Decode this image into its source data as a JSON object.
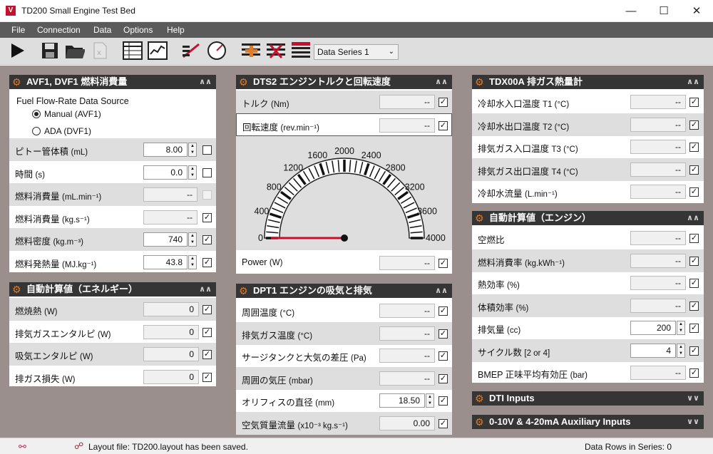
{
  "window": {
    "title": "TD200 Small Engine Test Bed",
    "icon": "V"
  },
  "menu": [
    "File",
    "Connection",
    "Data",
    "Options",
    "Help"
  ],
  "toolbar": {
    "series_value": "Data Series 1"
  },
  "avf": {
    "title": "AVF1, DVF1 燃料消費量",
    "source_label": "Fuel Flow-Rate Data Source",
    "manual": "Manual (AVF1)",
    "ada": "ADA (DVF1)",
    "rows": [
      {
        "label": "ピトー管体積",
        "unit": "(mL)",
        "value": "8.00",
        "spin": true,
        "checked": false,
        "edit": true
      },
      {
        "label": "時間",
        "unit": "(s)",
        "value": "0.0",
        "spin": true,
        "checked": false,
        "edit": true
      },
      {
        "label": "燃料消費量",
        "unit": "(mL.min⁻¹)",
        "value": "--",
        "spin": false,
        "checked": false,
        "disabled": true
      },
      {
        "label": "燃料消費量",
        "unit": "(kg.s⁻¹)",
        "value": "--",
        "spin": false,
        "checked": true
      },
      {
        "label": "燃料密度",
        "unit": "(kg.m⁻³)",
        "value": "740",
        "spin": true,
        "checked": true,
        "edit": true
      },
      {
        "label": "燃料発熱量",
        "unit": "(MJ.kg⁻¹)",
        "value": "43.8",
        "spin": true,
        "checked": true,
        "edit": true
      }
    ]
  },
  "energy": {
    "title": "自動計算値（エネルギー）",
    "rows": [
      {
        "label": "燃焼熱",
        "unit": "(W)",
        "value": "0",
        "checked": true
      },
      {
        "label": "排気ガスエンタルピ",
        "unit": "(W)",
        "value": "0",
        "checked": true
      },
      {
        "label": "吸気エンタルピ",
        "unit": "(W)",
        "value": "0",
        "checked": true
      },
      {
        "label": "排ガス損失",
        "unit": "(W)",
        "value": "0",
        "checked": true
      }
    ]
  },
  "dts": {
    "title": "DTS2 エンジントルクと回転速度",
    "torque": {
      "label": "トルク",
      "unit": "(Nm)",
      "value": "--"
    },
    "speed": {
      "label": "回転速度",
      "unit": "(rev.min⁻¹)",
      "value": "--"
    },
    "gauge_ticks": [
      "0",
      "400",
      "800",
      "1200",
      "1600",
      "2000",
      "2400",
      "2800",
      "3200",
      "3600",
      "4000"
    ],
    "gauge_max": 4000,
    "gauge_value": 0,
    "power": {
      "label": "Power",
      "unit": "(W)",
      "value": "--"
    }
  },
  "dpt": {
    "title": "DPT1 エンジンの吸気と排気",
    "rows": [
      {
        "label": "周囲温度",
        "unit": "(°C)",
        "value": "--",
        "checked": true
      },
      {
        "label": "排気ガス温度",
        "unit": "(°C)",
        "value": "--",
        "checked": true
      },
      {
        "label": "サージタンクと大気の差圧",
        "unit": "(Pa)",
        "value": "--",
        "checked": true
      },
      {
        "label": "周囲の気圧",
        "unit": "(mbar)",
        "value": "--",
        "checked": true
      },
      {
        "label": "オリフィスの直径",
        "unit": "(mm)",
        "value": "18.50",
        "checked": true,
        "spin": true,
        "edit": true
      },
      {
        "label": "空気質量流量",
        "unit": "(x10⁻³ kg.s⁻¹)",
        "value": "0.00",
        "checked": true
      }
    ]
  },
  "tdx": {
    "title": "TDX00A 排ガス熱量計",
    "rows": [
      {
        "label": "冷却水入口温度",
        "unit": "T1 (°C)",
        "value": "--",
        "checked": true
      },
      {
        "label": "冷却水出口温度",
        "unit": "T2 (°C)",
        "value": "--",
        "checked": true
      },
      {
        "label": "排気ガス入口温度",
        "unit": "T3 (°C)",
        "value": "--",
        "checked": true
      },
      {
        "label": "排気ガス出口温度",
        "unit": "T4 (°C)",
        "value": "--",
        "checked": true
      },
      {
        "label": "冷却水流量",
        "unit": "(L.min⁻¹)",
        "value": "--",
        "checked": true
      }
    ]
  },
  "calc": {
    "title": "自動計算値（エンジン）",
    "rows": [
      {
        "label": "空燃比",
        "unit": "",
        "value": "--",
        "checked": true
      },
      {
        "label": "燃料消費率",
        "unit": "(kg.kWh⁻¹)",
        "value": "--",
        "checked": true
      },
      {
        "label": "熱効率",
        "unit": "(%)",
        "value": "--",
        "checked": true
      },
      {
        "label": "体積効率",
        "unit": "(%)",
        "value": "--",
        "checked": true
      },
      {
        "label": "排気量",
        "unit": "(cc)",
        "value": "200",
        "checked": true,
        "spin": true,
        "edit": true
      },
      {
        "label": "サイクル数",
        "unit": "[2 or 4]",
        "value": "4",
        "checked": true,
        "spin": true,
        "edit": true
      },
      {
        "label": "BMEP 正味平均有効圧",
        "unit": "(bar)",
        "value": "--",
        "checked": true
      }
    ]
  },
  "dti": {
    "title": "DTI Inputs"
  },
  "aux": {
    "title": "0-10V & 4-20mA Auxiliary Inputs"
  },
  "status": {
    "layout": "Layout file: TD200.layout has been saved.",
    "rows": "Data Rows in Series: 0"
  }
}
